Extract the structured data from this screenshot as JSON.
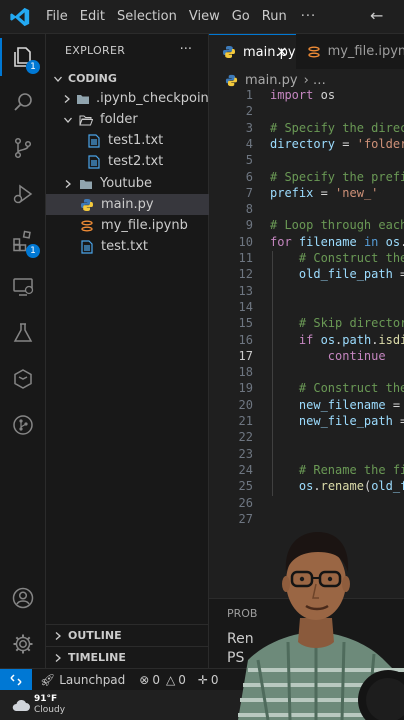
{
  "menu": [
    "File",
    "Edit",
    "Selection",
    "View",
    "Go",
    "Run",
    "···"
  ],
  "activity_badges": {
    "explorer": "1",
    "extensions": "1"
  },
  "explorer": {
    "header": "EXPLORER",
    "more": "···",
    "section": "CODING",
    "tree": [
      {
        "label": ".ipynb_checkpoints",
        "kind": "folder-collapsed"
      },
      {
        "label": "folder",
        "kind": "folder-open"
      },
      {
        "label": "test1.txt",
        "kind": "file-txt"
      },
      {
        "label": "test2.txt",
        "kind": "file-txt"
      },
      {
        "label": "Youtube",
        "kind": "folder-collapsed"
      },
      {
        "label": "main.py",
        "kind": "file-py",
        "selected": true
      },
      {
        "label": "my_file.ipynb",
        "kind": "file-ipynb"
      },
      {
        "label": "test.txt",
        "kind": "file-txt"
      }
    ],
    "outline": "OUTLINE",
    "timeline": "TIMELINE"
  },
  "tabs": [
    {
      "label": "main.py",
      "active": true,
      "close": "×"
    },
    {
      "label": "my_file.ipynb",
      "active": false
    }
  ],
  "breadcrumb": {
    "file": "main.py",
    "more": "› …"
  },
  "code_lines": [
    {
      "n": "1",
      "t": [
        [
          "kw",
          "import"
        ],
        [
          "op",
          " "
        ],
        [
          "op",
          "os"
        ]
      ]
    },
    {
      "n": "2",
      "t": []
    },
    {
      "n": "3",
      "t": [
        [
          "cm",
          "# Specify the directo"
        ]
      ]
    },
    {
      "n": "4",
      "t": [
        [
          "vr",
          "directory"
        ],
        [
          "op",
          " = "
        ],
        [
          "st",
          "'folder/"
        ]
      ]
    },
    {
      "n": "5",
      "t": []
    },
    {
      "n": "6",
      "t": [
        [
          "cm",
          "# Specify the prefix"
        ]
      ]
    },
    {
      "n": "7",
      "t": [
        [
          "vr",
          "prefix"
        ],
        [
          "op",
          " = "
        ],
        [
          "st",
          "'new_'"
        ]
      ]
    },
    {
      "n": "8",
      "t": []
    },
    {
      "n": "9",
      "t": [
        [
          "cm",
          "# Loop through each "
        ]
      ]
    },
    {
      "n": "10",
      "t": [
        [
          "kw",
          "for"
        ],
        [
          "op",
          " "
        ],
        [
          "vr",
          "filename"
        ],
        [
          "op",
          " "
        ],
        [
          "bl",
          "in"
        ],
        [
          "op",
          " "
        ],
        [
          "vr",
          "os"
        ],
        [
          "op",
          "."
        ],
        [
          "vr",
          "li"
        ]
      ]
    },
    {
      "n": "11",
      "t": [
        [
          "op",
          "    "
        ],
        [
          "cm",
          "# Construct the "
        ]
      ]
    },
    {
      "n": "12",
      "t": [
        [
          "op",
          "    "
        ],
        [
          "vr",
          "old_file_path"
        ],
        [
          "op",
          " = "
        ],
        [
          "vr",
          "o"
        ]
      ]
    },
    {
      "n": "13",
      "t": []
    },
    {
      "n": "14",
      "t": []
    },
    {
      "n": "15",
      "t": [
        [
          "op",
          "    "
        ],
        [
          "cm",
          "# Skip directorie"
        ]
      ]
    },
    {
      "n": "16",
      "t": [
        [
          "op",
          "    "
        ],
        [
          "kw",
          "if"
        ],
        [
          "op",
          " "
        ],
        [
          "vr",
          "os"
        ],
        [
          "op",
          "."
        ],
        [
          "vr",
          "path"
        ],
        [
          "op",
          "."
        ],
        [
          "fn",
          "isdir"
        ]
      ]
    },
    {
      "n": "17",
      "t": [
        [
          "op",
          "        "
        ],
        [
          "kw",
          "continue"
        ]
      ],
      "active": true
    },
    {
      "n": "18",
      "t": []
    },
    {
      "n": "19",
      "t": [
        [
          "op",
          "    "
        ],
        [
          "cm",
          "# Construct the "
        ]
      ]
    },
    {
      "n": "20",
      "t": [
        [
          "op",
          "    "
        ],
        [
          "vr",
          "new_filename"
        ],
        [
          "op",
          " = "
        ],
        [
          "vr",
          "pr"
        ]
      ]
    },
    {
      "n": "21",
      "t": [
        [
          "op",
          "    "
        ],
        [
          "vr",
          "new_file_path"
        ],
        [
          "op",
          " = "
        ],
        [
          "vr",
          "o"
        ]
      ]
    },
    {
      "n": "22",
      "t": []
    },
    {
      "n": "23",
      "t": []
    },
    {
      "n": "24",
      "t": [
        [
          "op",
          "    "
        ],
        [
          "cm",
          "# Rename the fil"
        ]
      ]
    },
    {
      "n": "25",
      "t": [
        [
          "op",
          "    "
        ],
        [
          "vr",
          "os"
        ],
        [
          "op",
          "."
        ],
        [
          "fn",
          "rename"
        ],
        [
          "op",
          "("
        ],
        [
          "vr",
          "old_fil"
        ]
      ]
    },
    {
      "n": "26",
      "t": []
    },
    {
      "n": "27",
      "t": []
    }
  ],
  "panel": {
    "tab": "PROB",
    "line1": "Ren",
    "line2": "PS"
  },
  "status": {
    "launchpad": "Launchpad",
    "errors": "0",
    "warnings": "0",
    "ports": "0"
  },
  "taskbar": {
    "temp": "91°F",
    "condition": "Cloudy"
  },
  "colors": {
    "accent": "#0078d4",
    "bg": "#1f1f1f",
    "sidebar": "#181818"
  }
}
